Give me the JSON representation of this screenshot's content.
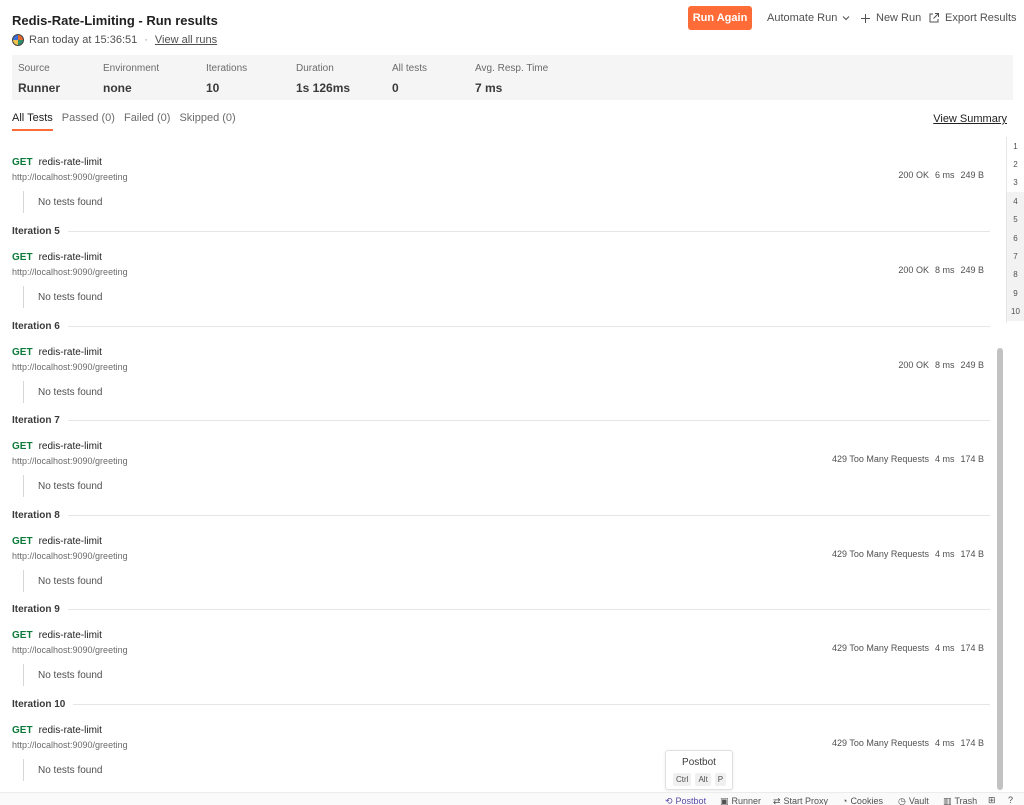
{
  "header": {
    "title": "Redis-Rate-Limiting - Run results",
    "ran_text": "Ran today at 15:36:51",
    "separator": "·",
    "view_all_runs": "View all runs",
    "run_again": "Run Again",
    "automate_run": "Automate Run",
    "new_run": "New Run",
    "export_results": "Export Results"
  },
  "stats": [
    {
      "label": "Source",
      "value": "Runner"
    },
    {
      "label": "Environment",
      "value": "none"
    },
    {
      "label": "Iterations",
      "value": "10"
    },
    {
      "label": "Duration",
      "value": "1s 126ms"
    },
    {
      "label": "All tests",
      "value": "0"
    },
    {
      "label": "Avg. Resp. Time",
      "value": "7 ms"
    }
  ],
  "tabs": [
    "All Tests",
    "Passed (0)",
    "Failed (0)",
    "Skipped (0)"
  ],
  "view_summary": "View Summary",
  "requests": [
    {
      "method": "GET",
      "name": "redis-rate-limit",
      "url": "http://localhost:9090/greeting",
      "status": "200 OK",
      "time": "6 ms",
      "size": "249 B",
      "tests": "No tests found"
    },
    {
      "iteration": "Iteration 5",
      "method": "GET",
      "name": "redis-rate-limit",
      "url": "http://localhost:9090/greeting",
      "status": "200 OK",
      "time": "8 ms",
      "size": "249 B",
      "tests": "No tests found"
    },
    {
      "iteration": "Iteration 6",
      "method": "GET",
      "name": "redis-rate-limit",
      "url": "http://localhost:9090/greeting",
      "status": "200 OK",
      "time": "8 ms",
      "size": "249 B",
      "tests": "No tests found"
    },
    {
      "iteration": "Iteration 7",
      "method": "GET",
      "name": "redis-rate-limit",
      "url": "http://localhost:9090/greeting",
      "status": "429 Too Many Requests",
      "time": "4 ms",
      "size": "174 B",
      "tests": "No tests found"
    },
    {
      "iteration": "Iteration 8",
      "method": "GET",
      "name": "redis-rate-limit",
      "url": "http://localhost:9090/greeting",
      "status": "429 Too Many Requests",
      "time": "4 ms",
      "size": "174 B",
      "tests": "No tests found"
    },
    {
      "iteration": "Iteration 9",
      "method": "GET",
      "name": "redis-rate-limit",
      "url": "http://localhost:9090/greeting",
      "status": "429 Too Many Requests",
      "time": "4 ms",
      "size": "174 B",
      "tests": "No tests found"
    },
    {
      "iteration": "Iteration 10",
      "method": "GET",
      "name": "redis-rate-limit",
      "url": "http://localhost:9090/greeting",
      "status": "429 Too Many Requests",
      "time": "4 ms",
      "size": "174 B",
      "tests": "No tests found"
    }
  ],
  "iteration_nav": [
    "1",
    "2",
    "3",
    "4",
    "5",
    "6",
    "7",
    "8",
    "9",
    "10"
  ],
  "postbot_popup": {
    "title": "Postbot",
    "keys": [
      "Ctrl",
      "Alt",
      "P"
    ]
  },
  "footer": {
    "postbot": "Postbot",
    "runner": "Runner",
    "start_proxy": "Start Proxy",
    "cookies": "Cookies",
    "vault": "Vault",
    "trash": "Trash"
  },
  "colors": {
    "accent": "#ff6c37",
    "method_get": "#0c7a3a",
    "footer_active": "#5a4aa8"
  }
}
